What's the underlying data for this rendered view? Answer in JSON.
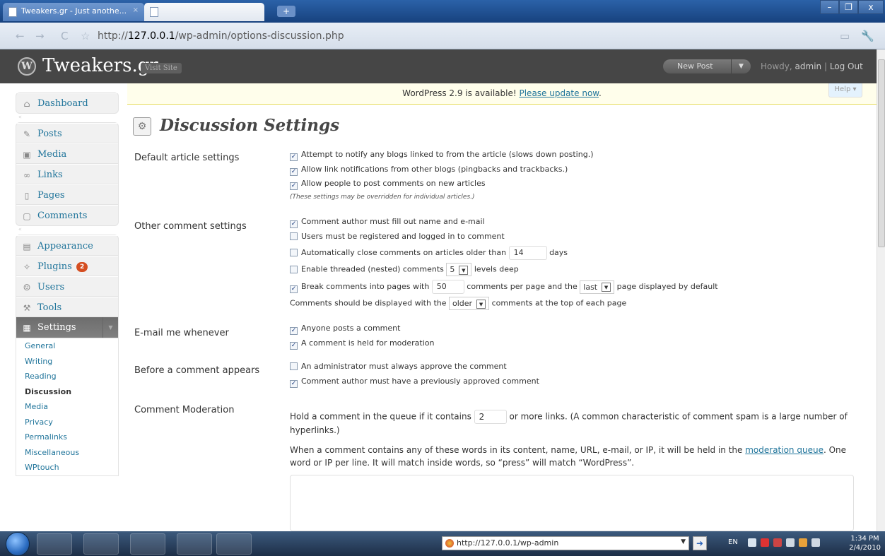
{
  "browser": {
    "tabs": [
      {
        "label": "Tweakers.gr - Just anothe...",
        "active": false
      },
      {
        "label": "",
        "active": true
      }
    ],
    "new_tab_icon": "plus-icon",
    "window_controls": {
      "minimize": "–",
      "maximize": "❐",
      "close": "x"
    },
    "url_prefix": "http://",
    "url_host": "127.0.0.1",
    "url_path": "/wp-admin/options-discussion.php"
  },
  "wp_header": {
    "site_name": "Tweakers.gr",
    "visit_site": "Visit Site",
    "new_post": "New Post",
    "howdy_prefix": "Howdy, ",
    "user": "admin",
    "separator": " | ",
    "logout": "Log Out"
  },
  "update_notice": {
    "text": "WordPress 2.9 is available! ",
    "link": "Please update now",
    "suffix": ".",
    "help": "Help ▾"
  },
  "sidebar": {
    "group1": [
      {
        "label": "Dashboard",
        "icon": "home-icon"
      }
    ],
    "group2": [
      {
        "label": "Posts",
        "icon": "pin-icon"
      },
      {
        "label": "Media",
        "icon": "media-icon"
      },
      {
        "label": "Links",
        "icon": "link-icon"
      },
      {
        "label": "Pages",
        "icon": "page-icon"
      },
      {
        "label": "Comments",
        "icon": "comment-icon"
      }
    ],
    "group3": [
      {
        "label": "Appearance",
        "icon": "appearance-icon"
      },
      {
        "label": "Plugins",
        "icon": "plugin-icon",
        "badge": "2"
      },
      {
        "label": "Users",
        "icon": "users-icon"
      },
      {
        "label": "Tools",
        "icon": "tools-icon"
      },
      {
        "label": "Settings",
        "icon": "settings-icon"
      }
    ],
    "settings_submenu": [
      "General",
      "Writing",
      "Reading",
      "Discussion",
      "Media",
      "Privacy",
      "Permalinks",
      "Miscellaneous",
      "WPtouch"
    ],
    "current_submenu": "Discussion"
  },
  "page": {
    "title": "Discussion Settings"
  },
  "sections": {
    "default_article": {
      "label": "Default article settings",
      "opt1": "Attempt to notify any blogs linked to from the article (slows down posting.)",
      "opt2": "Allow link notifications from other blogs (pingbacks and trackbacks.)",
      "opt3": "Allow people to post comments on new articles",
      "note": "(These settings may be overridden for individual articles.)"
    },
    "other_comment": {
      "label": "Other comment settings",
      "opt1": "Comment author must fill out name and e-mail",
      "opt2": "Users must be registered and logged in to comment",
      "opt3_before": "Automatically close comments on articles older than",
      "opt3_value": "14",
      "opt3_after": "days",
      "opt4_before": "Enable threaded (nested) comments",
      "opt4_value": "5",
      "opt4_after": "levels deep",
      "opt5_before": "Break comments into pages with",
      "opt5_value": "50",
      "opt5_mid": "comments per page and the",
      "opt5_select": "last",
      "opt5_after": "page displayed by default",
      "opt6_before": "Comments should be displayed with the",
      "opt6_select": "older",
      "opt6_after": "comments at the top of each page"
    },
    "email_me": {
      "label": "E-mail me whenever",
      "opt1": "Anyone posts a comment",
      "opt2": "A comment is held for moderation"
    },
    "before_appears": {
      "label": "Before a comment appears",
      "opt1": "An administrator must always approve the comment",
      "opt2": "Comment author must have a previously approved comment"
    },
    "moderation": {
      "label": "Comment Moderation",
      "hold_before": "Hold a comment in the queue if it contains",
      "hold_value": "2",
      "hold_after": "or more links. (A common characteristic of comment spam is a large number of hyperlinks.)",
      "words_before": "When a comment contains any of these words in its content, name, URL, e-mail, or IP, it will be held in the ",
      "words_link": "moderation queue",
      "words_after": ". One word or IP per line. It will match inside words, so “press” will match “WordPress”."
    }
  },
  "checkboxes": {
    "default_article": [
      true,
      true,
      true
    ],
    "other_comment": [
      true,
      false,
      false,
      false,
      true
    ],
    "email_me": [
      true,
      true
    ],
    "before_appears": [
      false,
      true
    ]
  },
  "taskbar": {
    "address": "http://127.0.0.1/wp-admin",
    "lang": "EN",
    "time": "1:34 PM",
    "date": "2/4/2010",
    "apps": [
      "chrome-icon",
      "explorer-icon",
      "messenger-icon",
      "word-icon",
      "media-center-icon"
    ]
  },
  "colors": {
    "header_bg": "#464646",
    "link": "#21759b",
    "notice_bg": "#fffeeb",
    "badge": "#d54e21",
    "settings_active": "#6d6d6d"
  }
}
